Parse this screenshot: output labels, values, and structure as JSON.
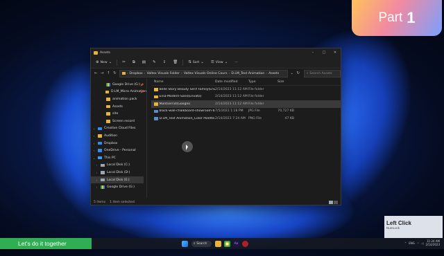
{
  "overlay": {
    "part_word": "Part",
    "part_number": "1"
  },
  "window": {
    "title": "Assets",
    "controls": [
      "–",
      "□",
      "✕"
    ]
  },
  "toolbar": {
    "new_label": "New",
    "sort_label": "Sort",
    "view_label": "View",
    "more_label": "···"
  },
  "address": {
    "crumbs": [
      "Dropbox",
      "Valtex Visuals Folder",
      "Valtex Visuals Online Cours",
      "D.LM_Text Animation",
      "Assets"
    ],
    "search_placeholder": "Search Assets"
  },
  "sidebar": {
    "items": [
      {
        "label": "Google Drive (G:)",
        "icon": "google-drive-icon",
        "pinned": true
      },
      {
        "label": "D.LM_Micro Animation",
        "icon": "folder-icon",
        "pinned": true
      },
      {
        "label": "animation pack",
        "icon": "folder-icon"
      },
      {
        "label": "Assets",
        "icon": "folder-icon"
      },
      {
        "label": "site",
        "icon": "folder-icon"
      },
      {
        "label": "Screen record",
        "icon": "folder-icon"
      },
      {
        "label": "Creative Cloud Files",
        "icon": "creative-cloud-icon",
        "expandable": true
      },
      {
        "label": "Audition",
        "icon": "folder-icon",
        "expandable": true
      },
      {
        "label": "Dropbox",
        "icon": "dropbox-icon",
        "expandable": true
      },
      {
        "label": "OneDrive - Personal",
        "icon": "onedrive-icon",
        "expandable": true
      },
      {
        "label": "This PC",
        "icon": "pc-icon",
        "expandable": true
      },
      {
        "label": "Local Disk (C:)",
        "icon": "drive-icon",
        "expandable": true
      },
      {
        "label": "Local Disk (D:)",
        "icon": "drive-icon",
        "expandable": true
      },
      {
        "label": "Local Disk (E:)",
        "icon": "drive-icon",
        "expandable": true,
        "selected": true
      },
      {
        "label": "Google Drive (G:)",
        "icon": "google-drive-icon",
        "expandable": true
      }
    ]
  },
  "table": {
    "headers": {
      "name": "Name",
      "date": "Date modified",
      "type": "Type",
      "size": "Size"
    },
    "rows": [
      {
        "name": "Belle Story Beauty Serif Family(Envato)",
        "date": "2/14/2023 11:12 AM",
        "type": "File folder",
        "size": "",
        "kind": "folder"
      },
      {
        "name": "Eina-Modern-Sans(Envato)",
        "date": "2/14/2023 11:12 AM",
        "type": "File folder",
        "size": "",
        "kind": "folder"
      },
      {
        "name": "Montserrat(Google)",
        "date": "2/14/2023 11:12 AM",
        "type": "File folder",
        "size": "",
        "kind": "folder",
        "selected": true
      },
      {
        "name": "black-wall-chalkboard-showroom-backg...",
        "date": "7/5/2022 1:18 PM",
        "type": "JPG File",
        "size": "70,727 KB",
        "kind": "image"
      },
      {
        "name": "D.LM_Text Animation_Color Palette.png",
        "date": "2/14/2023 7:24 AM",
        "type": "PNG File",
        "size": "47 KB",
        "kind": "image"
      }
    ]
  },
  "status": {
    "count": "5 items",
    "selection": "1 item selected"
  },
  "tooltip": {
    "title": "Left Click",
    "subtitle": "NumLock"
  },
  "banner": {
    "text": "Let's do it together"
  },
  "taskbar": {
    "search_label": "Search",
    "time": "11:24 AM",
    "date": "2/14/2023",
    "lang": "ENG"
  }
}
